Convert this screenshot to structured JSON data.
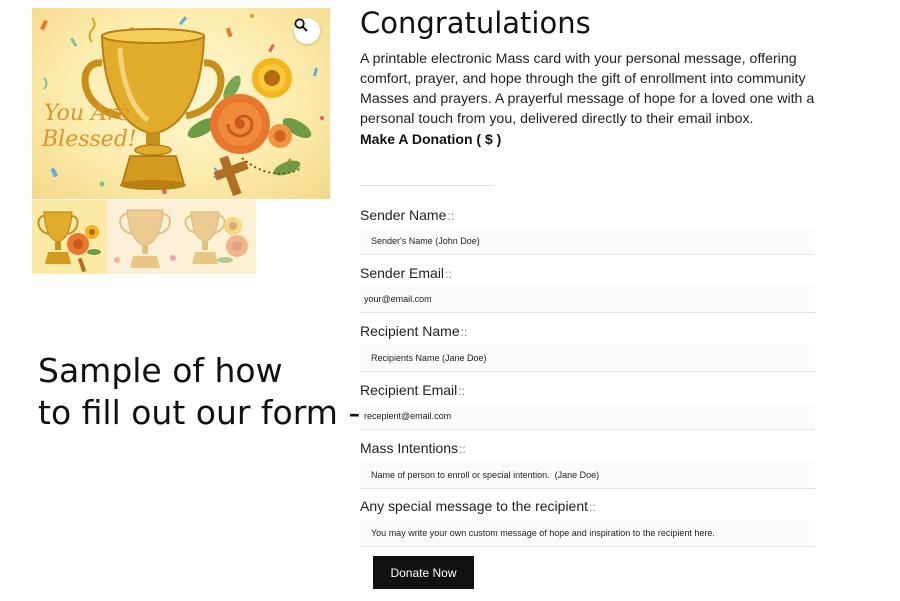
{
  "product": {
    "title": "Congratulations",
    "description": "A printable electronic Mass card with your personal message, offering comfort, prayer, and hope through the gift of enrollment into community Masses and prayers. A prayerful message of hope for a loved one with a personal touch from you, delivered directly to their email inbox.",
    "card_text": [
      "You Are",
      "Blessed!"
    ]
  },
  "gallery": {
    "zoom_icon": "magnifier-icon",
    "thumbnail_count": 3
  },
  "sample_note": {
    "line1": "Sample of how",
    "line2": "to fill out our form ->"
  },
  "form": {
    "donation": {
      "label": "Make A Donation ( $ )",
      "value": ""
    },
    "fields": [
      {
        "label": "Sender Name",
        "suffix": "::",
        "value": "Sender's Name (John Doe)"
      },
      {
        "label": "Sender Email",
        "suffix": "::",
        "value": "your@email.com"
      },
      {
        "label": "Recipient Name",
        "suffix": "::",
        "value": "Recipients Name (Jane Doe)"
      },
      {
        "label": "Recipient Email",
        "suffix": "::",
        "value": "recepient@email.com"
      },
      {
        "label": "Mass Intentions",
        "suffix": "::",
        "value": "Name of person to enroll or special intention.  (Jane Doe)"
      },
      {
        "label": "Any special message to the recipient",
        "suffix": "::",
        "value": "You may write your own custom message of hope and inspiration to the recipient here."
      }
    ],
    "submit_label": "Donate Now"
  },
  "colors": {
    "button_bg": "#111111",
    "card_gold": "#d9a521",
    "card_orange": "#e8772e",
    "card_background": "#fcecad"
  }
}
